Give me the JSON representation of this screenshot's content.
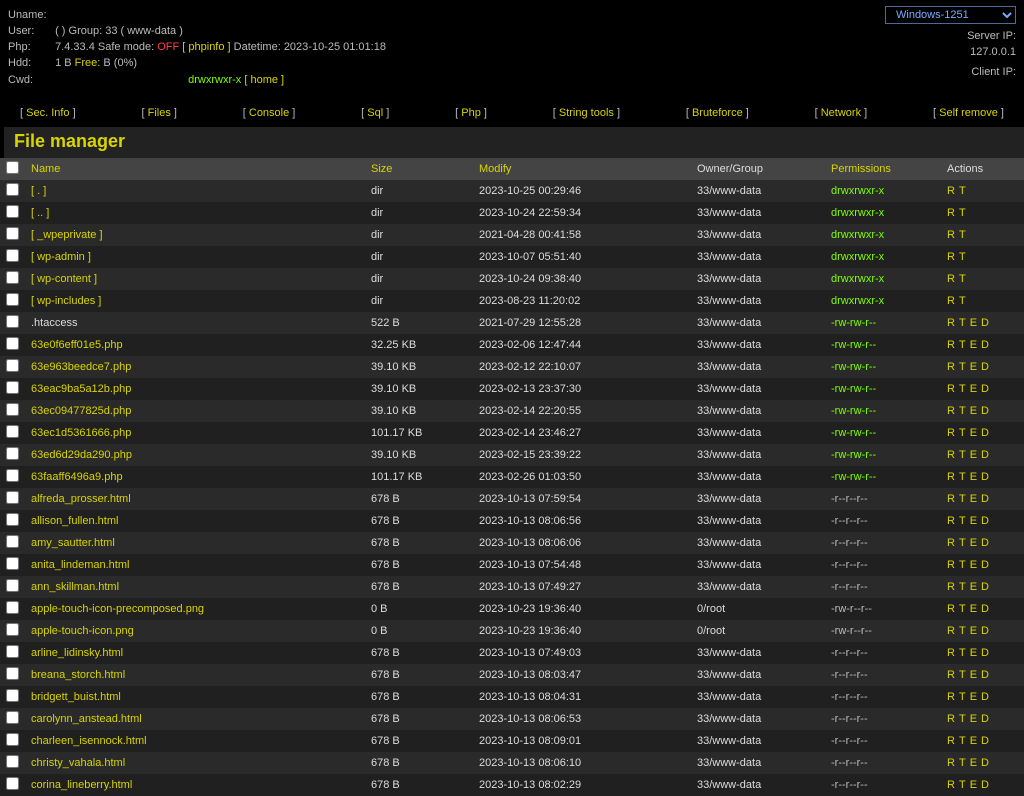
{
  "header": {
    "labels": {
      "uname": "Uname:",
      "user": "User:",
      "php": "Php:",
      "hdd": "Hdd:",
      "cwd": "Cwd:"
    },
    "user_left": "( )",
    "group_label": "Group:",
    "group_value": "33 ( www-data )",
    "php_ver": "7.4.33.4",
    "safe_mode_label": "Safe mode:",
    "safe_mode_value": "OFF",
    "phpinfo": "[ phpinfo ]",
    "datetime_label": "Datetime:",
    "datetime_value": "2023-10-25 01:01:18",
    "hdd_total": "1 B",
    "free_label": "Free:",
    "hdd_free": "B (0%)",
    "cwd_perm": "drwxrwxr-x",
    "home": "[ home ]",
    "encoding": "Windows-1251",
    "server_ip_label": "Server IP:",
    "server_ip": "127.0.0.1",
    "client_ip_label": "Client IP:"
  },
  "nav": {
    "sec": "Sec. Info",
    "files": "Files",
    "console": "Console",
    "sql": "Sql",
    "php": "Php",
    "str": "String tools",
    "brute": "Bruteforce",
    "net": "Network",
    "self": "Self remove"
  },
  "title": "File manager",
  "cols": {
    "name": "Name",
    "size": "Size",
    "modify": "Modify",
    "og": "Owner/Group",
    "perm": "Permissions",
    "act": "Actions"
  },
  "actions": {
    "r": "R",
    "t": "T",
    "e": "E",
    "d": "D"
  },
  "rows": [
    {
      "name": "[ . ]",
      "dir": true,
      "size": "dir",
      "mod": "2023-10-25 00:29:46",
      "og": "33/www-data",
      "perm": "drwxrwxr-x",
      "pc": "green",
      "acts": "rt"
    },
    {
      "name": "[ .. ]",
      "dir": true,
      "size": "dir",
      "mod": "2023-10-24 22:59:34",
      "og": "33/www-data",
      "perm": "drwxrwxr-x",
      "pc": "green",
      "acts": "rt"
    },
    {
      "name": "[ _wpeprivate ]",
      "dir": true,
      "size": "dir",
      "mod": "2021-04-28 00:41:58",
      "og": "33/www-data",
      "perm": "drwxrwxr-x",
      "pc": "green",
      "acts": "rt"
    },
    {
      "name": "[ wp-admin ]",
      "dir": true,
      "size": "dir",
      "mod": "2023-10-07 05:51:40",
      "og": "33/www-data",
      "perm": "drwxrwxr-x",
      "pc": "green",
      "acts": "rt"
    },
    {
      "name": "[ wp-content ]",
      "dir": true,
      "size": "dir",
      "mod": "2023-10-24 09:38:40",
      "og": "33/www-data",
      "perm": "drwxrwxr-x",
      "pc": "green",
      "acts": "rt"
    },
    {
      "name": "[ wp-includes ]",
      "dir": true,
      "size": "dir",
      "mod": "2023-08-23 11:20:02",
      "og": "33/www-data",
      "perm": "drwxrwxr-x",
      "pc": "green",
      "acts": "rt"
    },
    {
      "name": ".htaccess",
      "size": "522 B",
      "mod": "2021-07-29 12:55:28",
      "og": "33/www-data",
      "perm": "-rw-rw-r--",
      "pc": "green",
      "acts": "rted"
    },
    {
      "name": "63e0f6eff01e5.php",
      "size": "32.25 KB",
      "mod": "2023-02-06 12:47:44",
      "og": "33/www-data",
      "perm": "-rw-rw-r--",
      "pc": "green",
      "acts": "rted"
    },
    {
      "name": "63e963beedce7.php",
      "size": "39.10 KB",
      "mod": "2023-02-12 22:10:07",
      "og": "33/www-data",
      "perm": "-rw-rw-r--",
      "pc": "green",
      "acts": "rted"
    },
    {
      "name": "63eac9ba5a12b.php",
      "size": "39.10 KB",
      "mod": "2023-02-13 23:37:30",
      "og": "33/www-data",
      "perm": "-rw-rw-r--",
      "pc": "green",
      "acts": "rted"
    },
    {
      "name": "63ec09477825d.php",
      "size": "39.10 KB",
      "mod": "2023-02-14 22:20:55",
      "og": "33/www-data",
      "perm": "-rw-rw-r--",
      "pc": "green",
      "acts": "rted"
    },
    {
      "name": "63ec1d5361666.php",
      "size": "101.17 KB",
      "mod": "2023-02-14 23:46:27",
      "og": "33/www-data",
      "perm": "-rw-rw-r--",
      "pc": "green",
      "acts": "rted"
    },
    {
      "name": "63ed6d29da290.php",
      "size": "39.10 KB",
      "mod": "2023-02-15 23:39:22",
      "og": "33/www-data",
      "perm": "-rw-rw-r--",
      "pc": "green",
      "acts": "rted"
    },
    {
      "name": "63faaff6496a9.php",
      "size": "101.17 KB",
      "mod": "2023-02-26 01:03:50",
      "og": "33/www-data",
      "perm": "-rw-rw-r--",
      "pc": "green",
      "acts": "rted"
    },
    {
      "name": "alfreda_prosser.html",
      "size": "678 B",
      "mod": "2023-10-13 07:59:54",
      "og": "33/www-data",
      "perm": "-r--r--r--",
      "pc": "gray",
      "acts": "rted"
    },
    {
      "name": "allison_fullen.html",
      "size": "678 B",
      "mod": "2023-10-13 08:06:56",
      "og": "33/www-data",
      "perm": "-r--r--r--",
      "pc": "gray",
      "acts": "rted"
    },
    {
      "name": "amy_sautter.html",
      "size": "678 B",
      "mod": "2023-10-13 08:06:06",
      "og": "33/www-data",
      "perm": "-r--r--r--",
      "pc": "gray",
      "acts": "rted"
    },
    {
      "name": "anita_lindeman.html",
      "size": "678 B",
      "mod": "2023-10-13 07:54:48",
      "og": "33/www-data",
      "perm": "-r--r--r--",
      "pc": "gray",
      "acts": "rted"
    },
    {
      "name": "ann_skillman.html",
      "size": "678 B",
      "mod": "2023-10-13 07:49:27",
      "og": "33/www-data",
      "perm": "-r--r--r--",
      "pc": "gray",
      "acts": "rted"
    },
    {
      "name": "apple-touch-icon-precomposed.png",
      "size": "0 B",
      "mod": "2023-10-23 19:36:40",
      "og": "0/root",
      "perm": "-rw-r--r--",
      "pc": "gray",
      "acts": "rted"
    },
    {
      "name": "apple-touch-icon.png",
      "size": "0 B",
      "mod": "2023-10-23 19:36:40",
      "og": "0/root",
      "perm": "-rw-r--r--",
      "pc": "gray",
      "acts": "rted"
    },
    {
      "name": "arline_lidinsky.html",
      "size": "678 B",
      "mod": "2023-10-13 07:49:03",
      "og": "33/www-data",
      "perm": "-r--r--r--",
      "pc": "gray",
      "acts": "rted"
    },
    {
      "name": "breana_storch.html",
      "size": "678 B",
      "mod": "2023-10-13 08:03:47",
      "og": "33/www-data",
      "perm": "-r--r--r--",
      "pc": "gray",
      "acts": "rted"
    },
    {
      "name": "bridgett_buist.html",
      "size": "678 B",
      "mod": "2023-10-13 08:04:31",
      "og": "33/www-data",
      "perm": "-r--r--r--",
      "pc": "gray",
      "acts": "rted"
    },
    {
      "name": "carolynn_anstead.html",
      "size": "678 B",
      "mod": "2023-10-13 08:06:53",
      "og": "33/www-data",
      "perm": "-r--r--r--",
      "pc": "gray",
      "acts": "rted"
    },
    {
      "name": "charleen_isennock.html",
      "size": "678 B",
      "mod": "2023-10-13 08:09:01",
      "og": "33/www-data",
      "perm": "-r--r--r--",
      "pc": "gray",
      "acts": "rted"
    },
    {
      "name": "christy_vahala.html",
      "size": "678 B",
      "mod": "2023-10-13 08:06:10",
      "og": "33/www-data",
      "perm": "-r--r--r--",
      "pc": "gray",
      "acts": "rted"
    },
    {
      "name": "corina_lineberry.html",
      "size": "678 B",
      "mod": "2023-10-13 08:02:29",
      "og": "33/www-data",
      "perm": "-r--r--r--",
      "pc": "gray",
      "acts": "rted"
    }
  ]
}
